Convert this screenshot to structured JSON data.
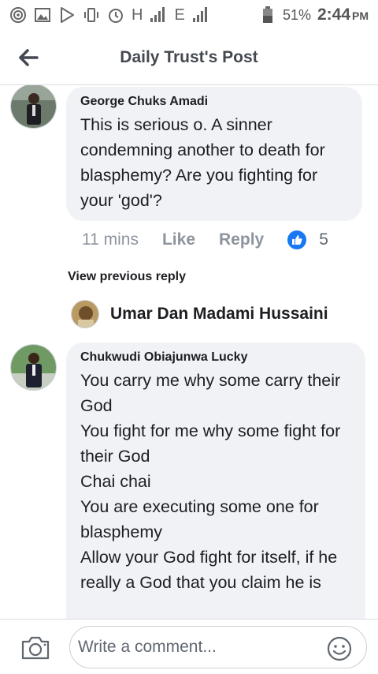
{
  "status_bar": {
    "battery": "51%",
    "time": "2:44",
    "ampm": "PM",
    "network_1": "H",
    "network_2": "E",
    "icons": [
      "hotspot-icon",
      "image-icon",
      "play-store-icon",
      "vibrate-icon",
      "alarm-icon",
      "signal-icon",
      "signal-icon",
      "battery-icon"
    ]
  },
  "header": {
    "title": "Daily Trust's Post",
    "back_icon": "back-arrow-icon"
  },
  "comments": [
    {
      "author": "George Chuks Amadi",
      "text": "This is serious o. A  sinner condemning another to death for blasphemy? Are you fighting for your 'god'?",
      "time": "11 mins",
      "like_label": "Like",
      "reply_label": "Reply",
      "reaction_count": "5"
    }
  ],
  "view_previous_reply": "View previous reply",
  "reply_preview": {
    "name": "Umar Dan Madami Hussaini"
  },
  "reply_comment": {
    "author": "Chukwudi Obiajunwa Lucky",
    "lines": [
      "You carry me why some carry their God",
      "You fight for me why some fight for their God",
      "Chai chai",
      "You are executing some one for blasphemy",
      "Allow your God fight for itself, if he really a God that you claim he is"
    ]
  },
  "composer": {
    "placeholder": "Write a comment...",
    "camera_icon": "camera-icon",
    "emoji_icon": "emoji-icon"
  },
  "colors": {
    "facebook_blue": "#1877f2",
    "bubble": "#f0f2f5",
    "muted_text": "#8d949e"
  }
}
